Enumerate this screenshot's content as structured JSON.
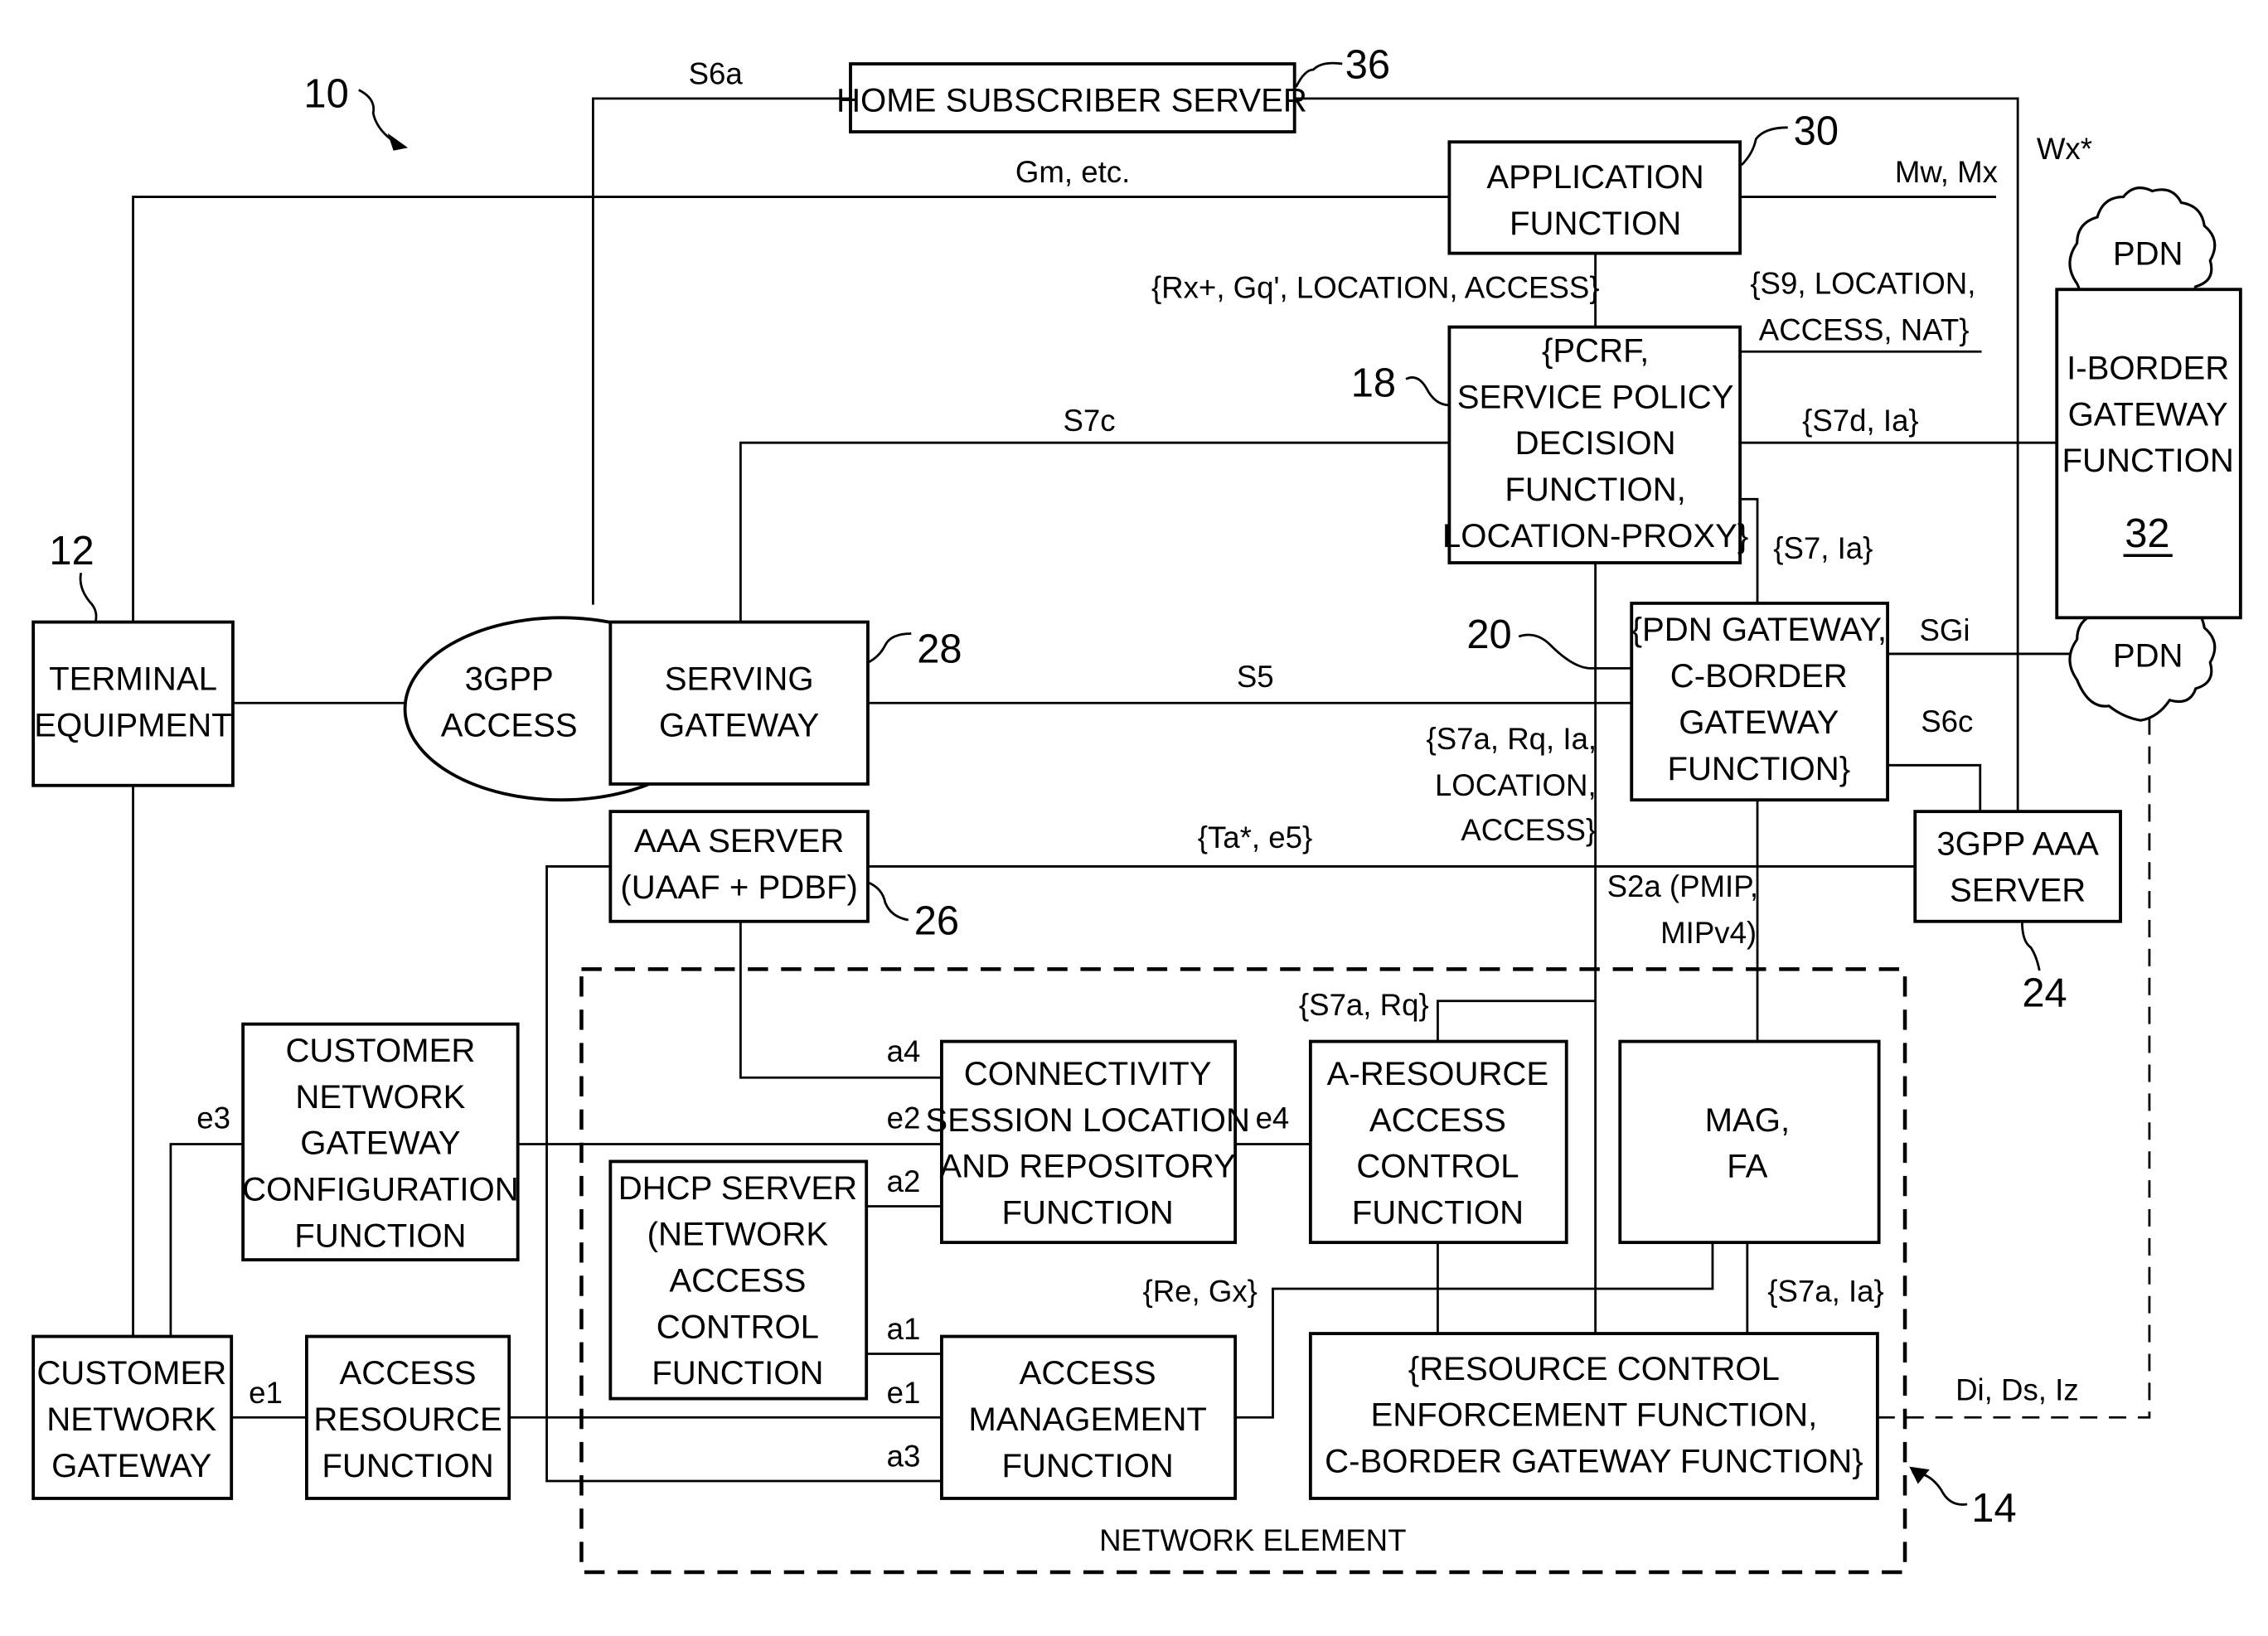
{
  "figure": {
    "reference": "10",
    "network_element_ref": "14",
    "network_element_label": "NETWORK ELEMENT"
  },
  "nodes": {
    "hss": {
      "ref": "36",
      "lines": [
        "HOME SUBSCRIBER SERVER"
      ]
    },
    "af": {
      "ref": "30",
      "lines": [
        "APPLICATION",
        "FUNCTION"
      ]
    },
    "pcrf": {
      "ref": "18",
      "lines": [
        "{PCRF,",
        "SERVICE POLICY",
        "DECISION",
        "FUNCTION,",
        "LOCATION-PROXY}"
      ]
    },
    "ibgf": {
      "ref": "32",
      "lines": [
        "I-BORDER",
        "GATEWAY",
        "FUNCTION"
      ]
    },
    "pdn_top": {
      "lines": [
        "PDN"
      ]
    },
    "pdn_mid": {
      "lines": [
        "PDN"
      ]
    },
    "te": {
      "ref": "12",
      "lines": [
        "TERMINAL",
        "EQUIPMENT"
      ]
    },
    "access3gpp": {
      "lines": [
        "3GPP",
        "ACCESS"
      ]
    },
    "sgw": {
      "ref": "28",
      "lines": [
        "SERVING",
        "GATEWAY"
      ]
    },
    "pgw": {
      "ref": "20",
      "lines": [
        "{PDN GATEWAY,",
        "C-BORDER",
        "GATEWAY",
        "FUNCTION}"
      ]
    },
    "aaa": {
      "ref": "26",
      "lines": [
        "AAA SERVER",
        "(UAAF + PDBF)"
      ]
    },
    "aaa3gpp": {
      "ref": "24",
      "lines": [
        "3GPP AAA",
        "SERVER"
      ]
    },
    "cngcf": {
      "lines": [
        "CUSTOMER",
        "NETWORK",
        "GATEWAY",
        "CONFIGURATION",
        "FUNCTION"
      ]
    },
    "clf": {
      "lines": [
        "CONNECTIVITY",
        "SESSION LOCATION",
        "AND REPOSITORY",
        "FUNCTION"
      ]
    },
    "aracf": {
      "lines": [
        "A-RESOURCE",
        "ACCESS",
        "CONTROL",
        "FUNCTION"
      ]
    },
    "mag": {
      "lines": [
        "MAG,",
        "FA"
      ]
    },
    "dhcp": {
      "lines": [
        "DHCP SERVER",
        "(NETWORK",
        "ACCESS",
        "CONTROL",
        "FUNCTION"
      ]
    },
    "cng": {
      "lines": [
        "CUSTOMER",
        "NETWORK",
        "GATEWAY"
      ]
    },
    "arf": {
      "lines": [
        "ACCESS",
        "RESOURCE",
        "FUNCTION"
      ]
    },
    "amf": {
      "lines": [
        "ACCESS",
        "MANAGEMENT",
        "FUNCTION"
      ]
    },
    "rcef": {
      "lines": [
        "{RESOURCE CONTROL",
        "ENFORCEMENT FUNCTION,",
        "C-BORDER GATEWAY FUNCTION}"
      ]
    }
  },
  "interfaces": {
    "s6a": "S6a",
    "gm": "Gm, etc.",
    "mwmx": "Mw, Mx",
    "wx": "Wx*",
    "rx": "{Rx+, Gq', LOCATION, ACCESS}",
    "s9": [
      "{S9, LOCATION,",
      "ACCESS, NAT}"
    ],
    "s7c": "S7c",
    "s7d": "{S7d, Ia}",
    "s7": "{S7, Ia}",
    "sgi": "SGi",
    "s5": "S5",
    "s6c": "S6c",
    "s7a_rq_ia": [
      "{S7a, Rq, Ia,",
      "LOCATION,",
      "ACCESS}"
    ],
    "ta": "{Ta*, e5}",
    "s2a": [
      "S2a (PMIP,",
      "MIPv4)"
    ],
    "s7a_rq": "{S7a, Rq}",
    "a4": "a4",
    "e2": "e2",
    "a2": "a2",
    "a1": "a1",
    "e1_inner": "e1",
    "a3": "a3",
    "e4": "e4",
    "e3": "e3",
    "e1": "e1",
    "re_gx": "{Re, Gx}",
    "s7a_ia": "{S7a, Ia}",
    "di": "Di, Ds, Iz"
  }
}
